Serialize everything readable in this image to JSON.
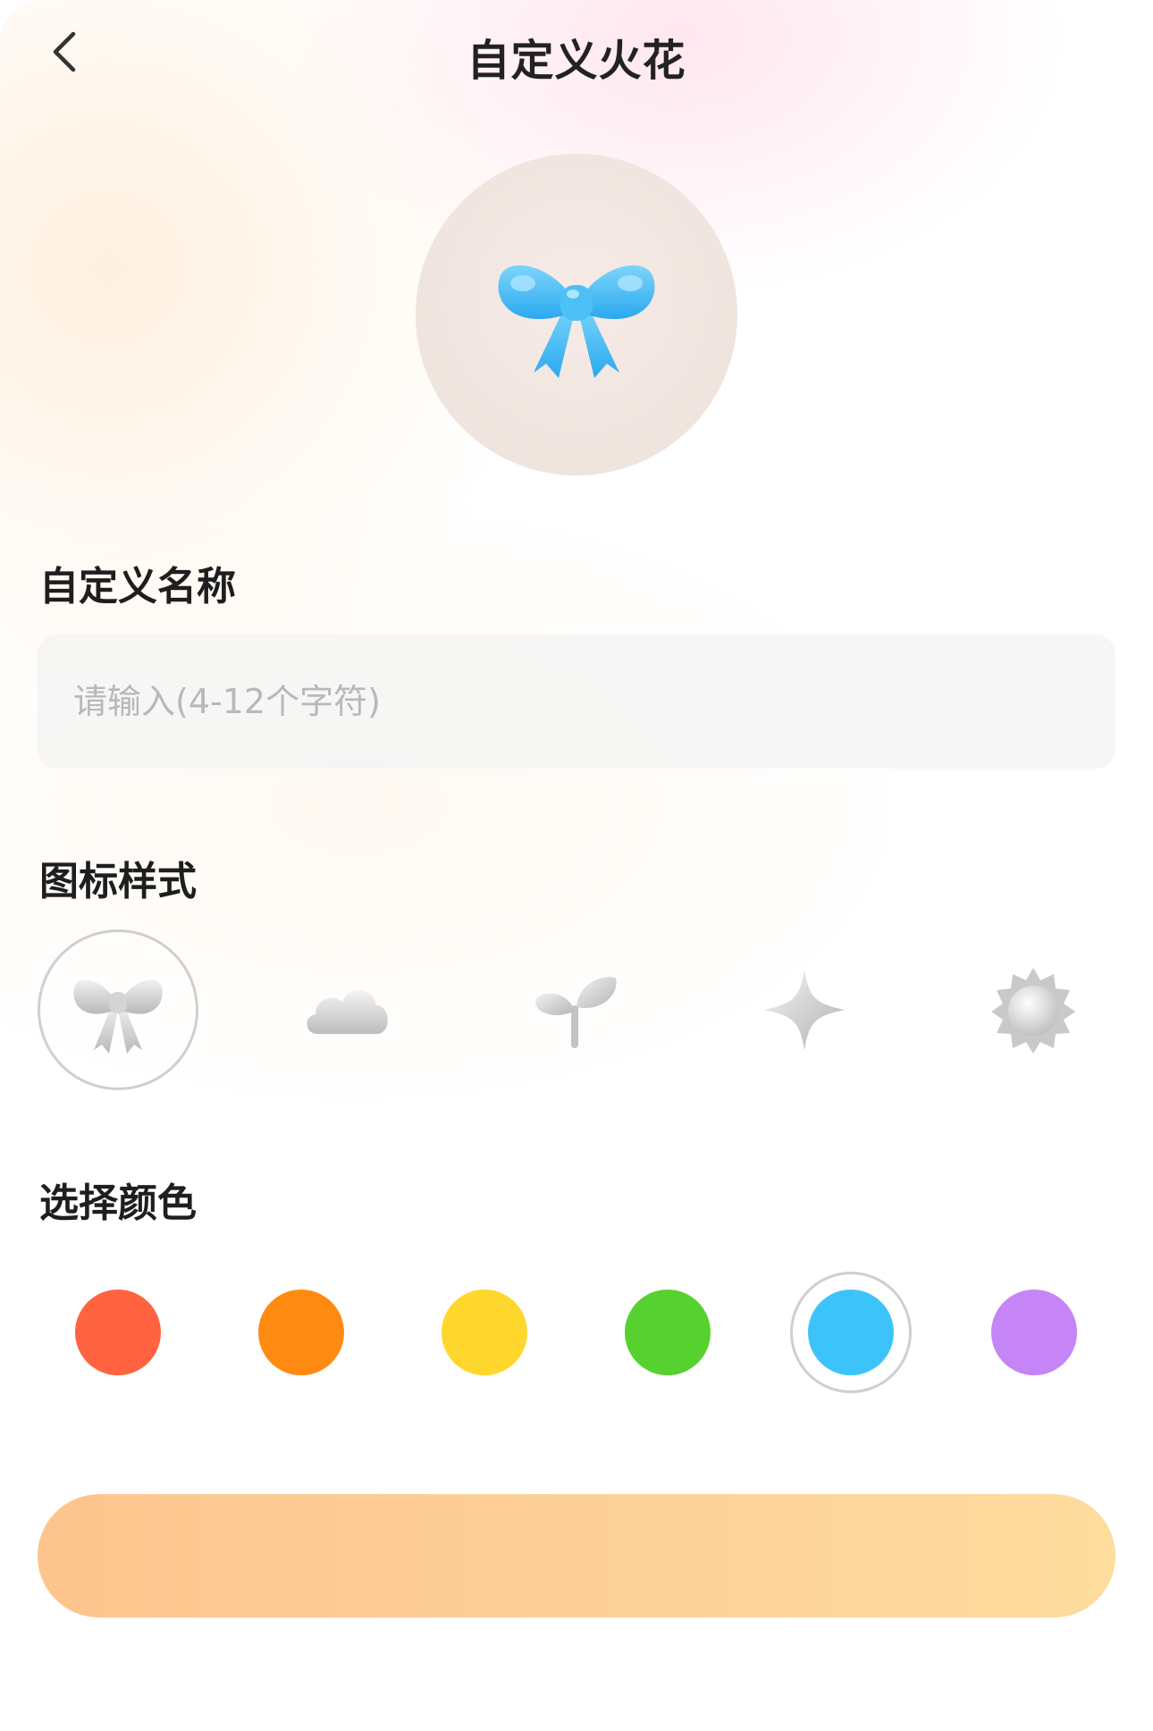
{
  "header": {
    "title": "自定义火花",
    "back_icon": "chevron-left-icon"
  },
  "preview": {
    "icon": "bow-icon",
    "color": "#3cb8f4"
  },
  "name_section": {
    "label": "自定义名称",
    "placeholder": "请输入(4-12个字符)",
    "value": ""
  },
  "icon_section": {
    "label": "图标样式",
    "options": [
      {
        "icon": "bow-icon",
        "selected": true
      },
      {
        "icon": "cloud-icon",
        "selected": false
      },
      {
        "icon": "sprout-icon",
        "selected": false
      },
      {
        "icon": "sparkle-icon",
        "selected": false
      },
      {
        "icon": "sun-icon",
        "selected": false
      }
    ]
  },
  "color_section": {
    "label": "选择颜色",
    "options": [
      {
        "color": "#ff6340",
        "selected": false
      },
      {
        "color": "#ff8a12",
        "selected": false
      },
      {
        "color": "#ffd72c",
        "selected": false
      },
      {
        "color": "#56d12f",
        "selected": false
      },
      {
        "color": "#3cc4fa",
        "selected": true
      },
      {
        "color": "#c685f6",
        "selected": false
      }
    ]
  },
  "confirm": {
    "label": ""
  }
}
